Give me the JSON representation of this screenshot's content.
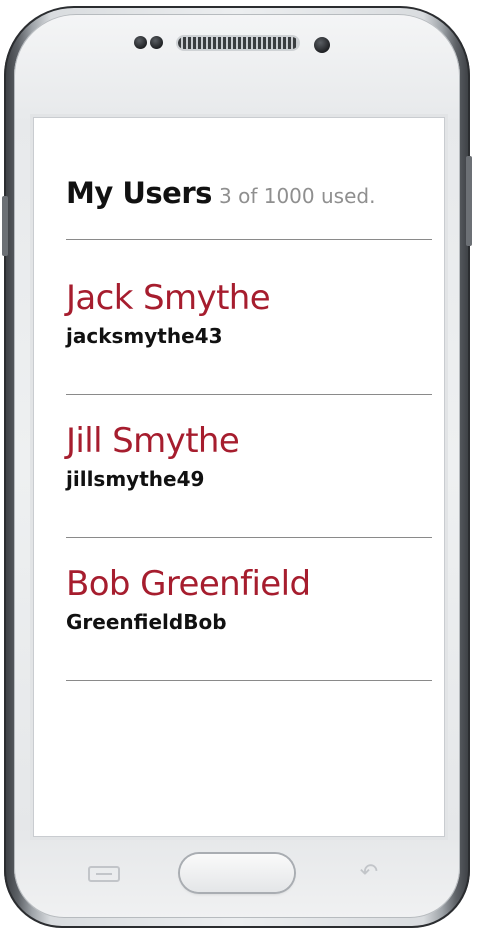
{
  "header": {
    "title": "My Users",
    "usage": "3 of 1000 used."
  },
  "users": [
    {
      "name": "Jack Smythe",
      "username": "jacksmythe43"
    },
    {
      "name": "Jill Smythe",
      "username": "jillsmythe49"
    },
    {
      "name": "Bob Greenfield",
      "username": "GreenfieldBob"
    }
  ],
  "colors": {
    "user_name": "#a61d2e",
    "title": "#111111",
    "usage": "#8f8f8f",
    "divider": "#8a8a8a"
  },
  "icons": {
    "menu_key": "menu-icon",
    "home_key": "home-button",
    "back_key": "back-arrow-icon"
  }
}
